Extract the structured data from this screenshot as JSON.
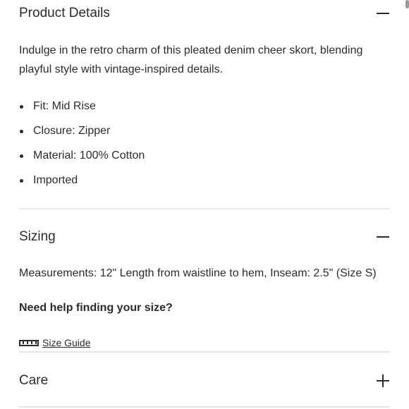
{
  "product_details": {
    "title": "Product Details",
    "toggle_icon": "minus-icon",
    "description": "Indulge in the retro charm of this pleated denim cheer skort, blending playful style with vintage-inspired details.",
    "bullets": [
      "Fit: Mid Rise",
      "Closure: Zipper",
      "Material: 100% Cotton",
      "Imported"
    ]
  },
  "sizing": {
    "title": "Sizing",
    "toggle_icon": "minus-icon",
    "measurements": "Measurements: 12\" Length from waistline to hem, Inseam: 2.5\" (Size S)",
    "help_text": "Need help finding your size?",
    "size_guide_icon": "ruler-icon",
    "size_guide_label": "Size Guide"
  },
  "care": {
    "title": "Care",
    "toggle_icon": "plus-icon"
  },
  "colors": {
    "text": "#2b2b2b",
    "divider": "#e6e6e6"
  }
}
